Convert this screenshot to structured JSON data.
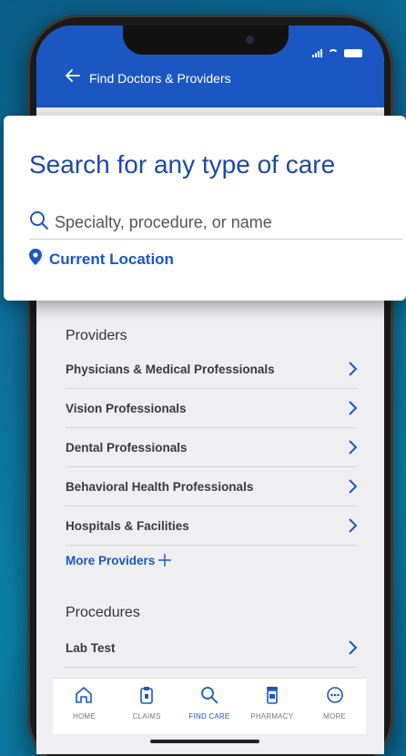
{
  "header": {
    "back_icon": "arrow-left-icon",
    "title": "Find Doctors & Providers"
  },
  "search": {
    "title": "Search for any type of care",
    "placeholder": "Specialty, procedure, or name",
    "location_label": "Current Location"
  },
  "providers": {
    "heading": "Providers",
    "items": [
      {
        "label": "Physicians & Medical Professionals"
      },
      {
        "label": "Vision Professionals"
      },
      {
        "label": "Dental Professionals"
      },
      {
        "label": "Behavioral Health Professionals"
      },
      {
        "label": "Hospitals & Facilities"
      }
    ],
    "more_label": "More Providers"
  },
  "procedures": {
    "heading": "Procedures",
    "items": [
      {
        "label": "Lab Test"
      }
    ]
  },
  "tabbar": {
    "tabs": [
      {
        "label": "HOME",
        "icon": "home-icon",
        "active": false
      },
      {
        "label": "CLAIMS",
        "icon": "clipboard-icon",
        "active": false
      },
      {
        "label": "FIND CARE",
        "icon": "search-icon",
        "active": true
      },
      {
        "label": "PHARMACY",
        "icon": "pill-bottle-icon",
        "active": false
      },
      {
        "label": "MORE",
        "icon": "more-icon",
        "active": false
      }
    ]
  },
  "colors": {
    "brand_blue": "#1a57c2",
    "title_blue": "#1b4aa8",
    "background": "#0b6f9c"
  }
}
